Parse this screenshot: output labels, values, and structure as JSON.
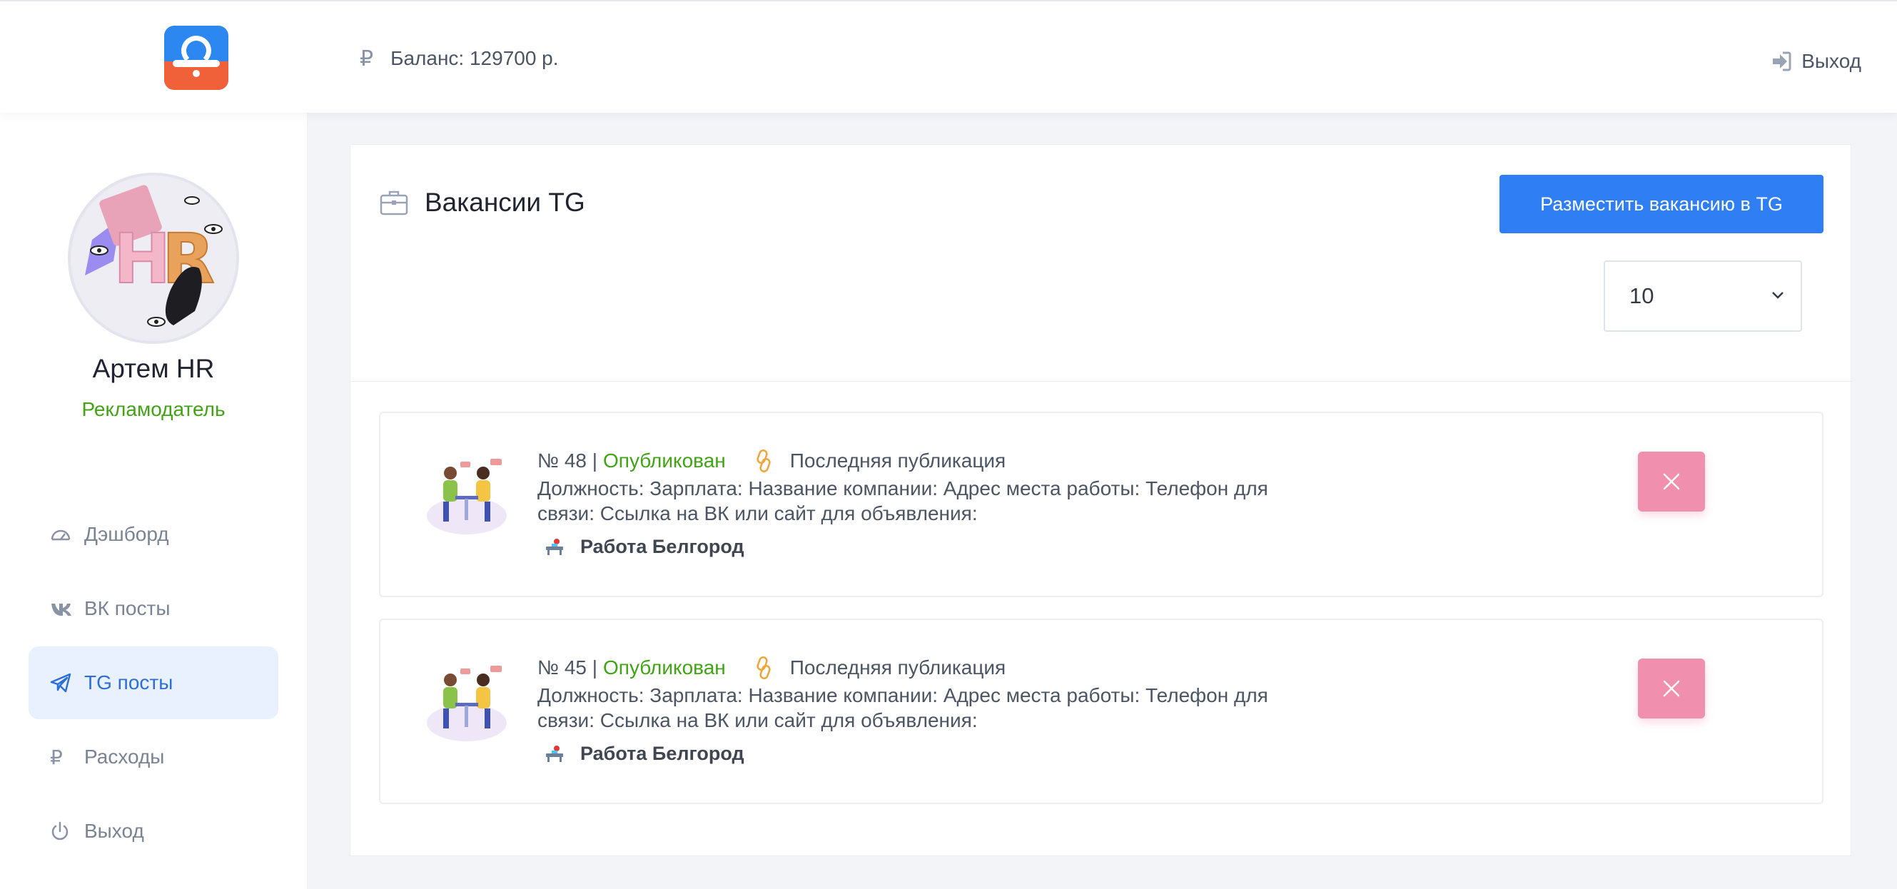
{
  "header": {
    "balance_label": "Баланс: 129700 р.",
    "currency_symbol": "₽",
    "logout_label": "Выход"
  },
  "profile": {
    "name": "Артем HR",
    "role": "Рекламодатель"
  },
  "sidebar": {
    "items": [
      {
        "label": "Дэшборд",
        "icon": "dashboard-icon",
        "active": false
      },
      {
        "label": "ВК посты",
        "icon": "vk-icon",
        "active": false
      },
      {
        "label": "TG посты",
        "icon": "telegram-icon",
        "active": true
      },
      {
        "label": "Расходы",
        "icon": "ruble-icon",
        "active": false
      },
      {
        "label": "Выход",
        "icon": "power-icon",
        "active": false
      }
    ]
  },
  "main": {
    "title": "Вакансии TG",
    "place_button_label": "Разместить вакансию в TG",
    "per_page_value": "10"
  },
  "posts": [
    {
      "number": "№ 48 |",
      "status": "Опубликован",
      "last_publication_label": "Последняя публикация",
      "description": "Должность: Зарплата: Название компании: Адрес места работы: Телефон для связи: Ссылка на ВК или сайт для объявления:",
      "channel": "Работа Белгород"
    },
    {
      "number": "№ 45 |",
      "status": "Опубликован",
      "last_publication_label": "Последняя публикация",
      "description": "Должность: Зарплата: Название компании: Адрес места работы: Телефон для связи: Ссылка на ВК или сайт для объявления:",
      "channel": "Работа Белгород"
    }
  ],
  "colors": {
    "accent": "#2f7ef3",
    "status_green": "#43a316",
    "delete_pink": "#f08fae",
    "active_nav_bg": "#e8f1fd"
  }
}
